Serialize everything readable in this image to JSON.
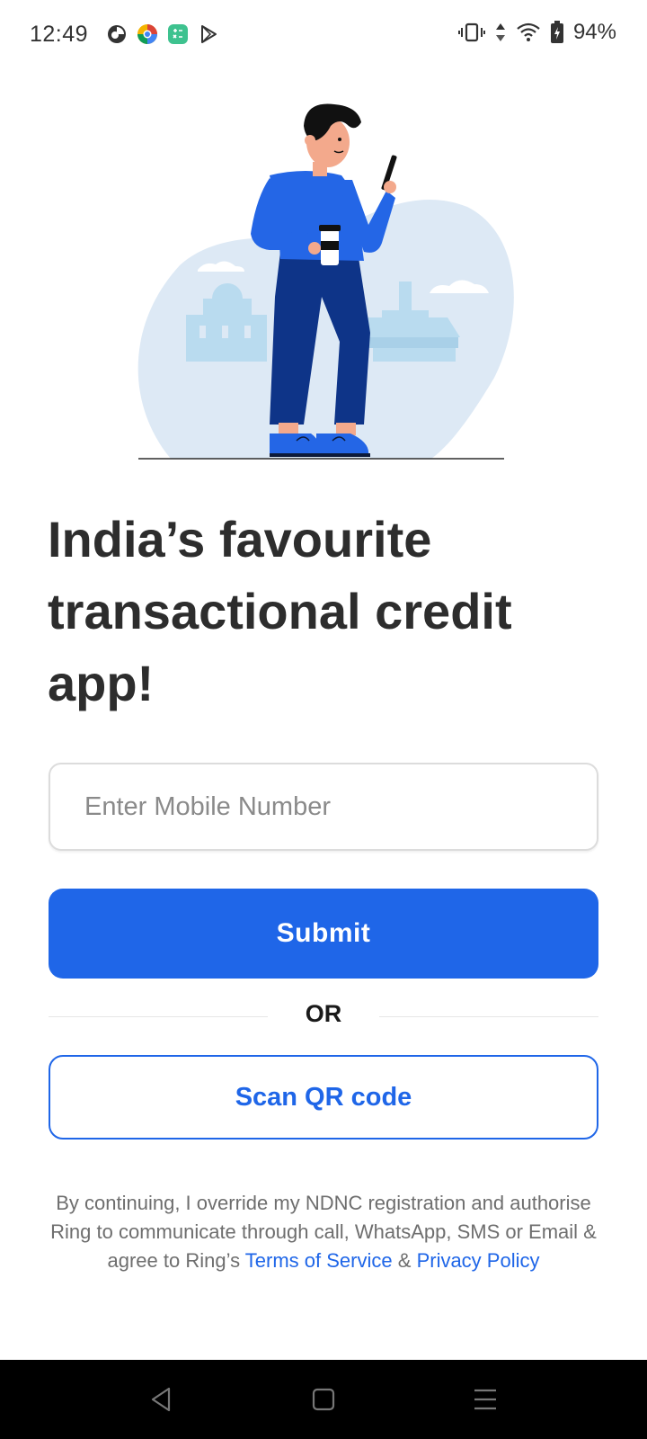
{
  "status_bar": {
    "time": "12:49",
    "battery": "94%",
    "left_icons": [
      "notification-app-icon",
      "chrome-icon",
      "calculator-app-icon",
      "play-store-icon"
    ],
    "right_icons": [
      "vibrate-icon",
      "data-arrows-icon",
      "wifi-icon",
      "battery-charging-icon"
    ]
  },
  "headline": "India’s favourite transactional credit app!",
  "mobile_input": {
    "placeholder": "Enter Mobile Number",
    "value": ""
  },
  "submit_label": "Submit",
  "or_label": "OR",
  "scan_label": "Scan QR code",
  "consent": {
    "text": "By continuing, I override my NDNC registration and authorise Ring to communicate through call, WhatsApp, SMS or Email & agree to Ring’s",
    "terms_link": "Terms of Service",
    "amp": "&",
    "privacy_link": "Privacy Policy"
  },
  "nav": [
    "back-icon",
    "home-icon",
    "recents-icon"
  ],
  "colors": {
    "accent": "#1f66e8",
    "text_dark": "#2d2d2d",
    "text_muted": "#6e6e6e",
    "illustration_bg": "#dde9f5"
  }
}
